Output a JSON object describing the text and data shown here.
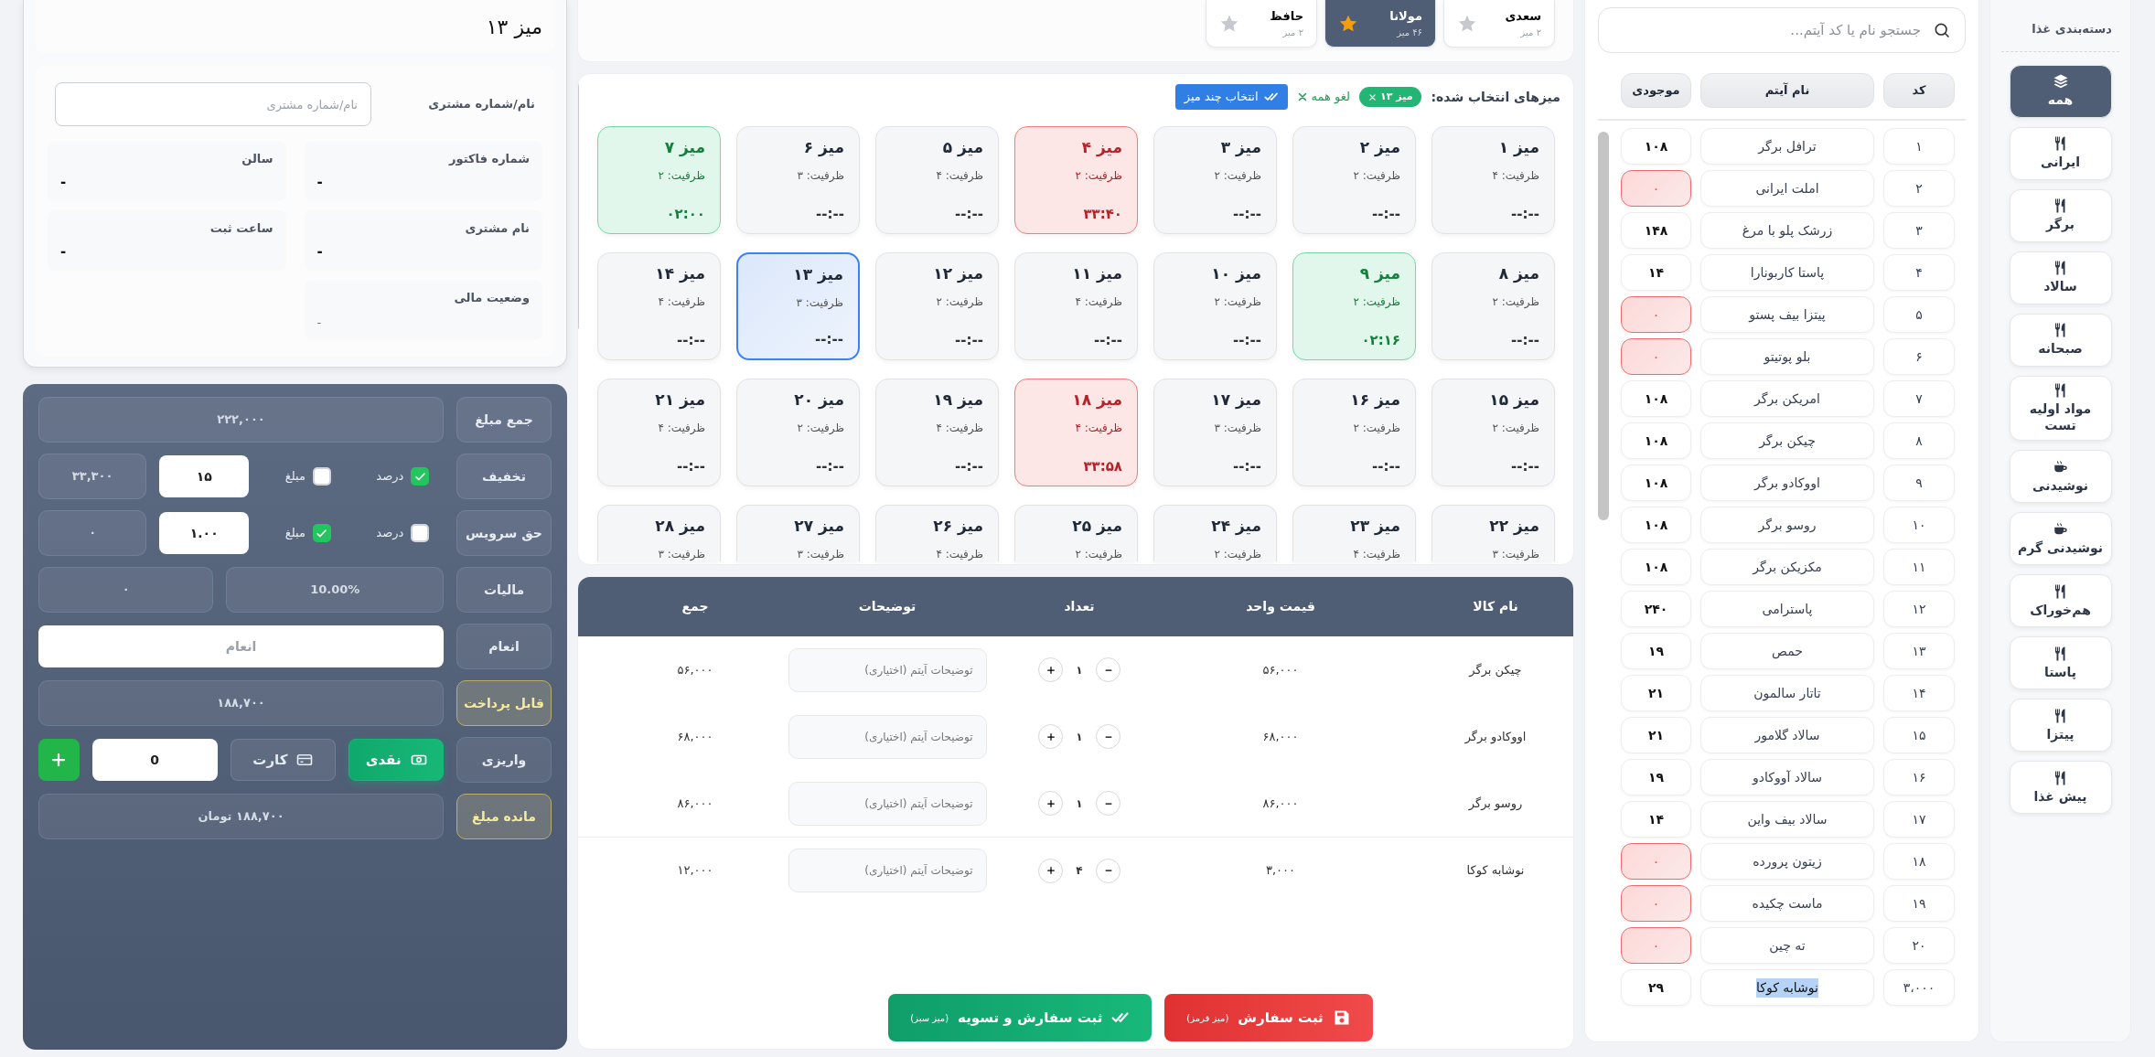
{
  "table_info": {
    "title": "میز ۱۳",
    "customer_label": "نام/شماره مشتری",
    "customer_placeholder": "نام/شماره مشتری",
    "fields": [
      {
        "label": "شماره فاکتور",
        "value": "-",
        "muted": false
      },
      {
        "label": "سالن",
        "value": "-",
        "muted": false
      },
      {
        "label": "نام مشتری",
        "value": "-",
        "muted": false
      },
      {
        "label": "ساعت ثبت",
        "value": "-",
        "muted": false
      },
      {
        "label": "وضعیت مالی",
        "value": "-",
        "muted": true
      }
    ]
  },
  "payment": [
    {
      "kind": "amount",
      "label": "جمع مبلغ",
      "value": "۲۲۲,۰۰۰",
      "highlight": false
    },
    {
      "kind": "adjust",
      "label": "تخفیف",
      "percent": {
        "label": "درصد",
        "checked": true
      },
      "fixed": {
        "label": "مبلغ",
        "checked": false
      },
      "input": "۱۵",
      "result": "۳۳,۳۰۰"
    },
    {
      "kind": "adjust",
      "label": "حق سرویس",
      "percent": {
        "label": "درصد",
        "checked": false
      },
      "fixed": {
        "label": "مبلغ",
        "checked": true
      },
      "input": "۱.۰۰",
      "result": "۰"
    },
    {
      "kind": "tax",
      "label": "مالیات",
      "rate": "10.00%",
      "value": "۰"
    },
    {
      "kind": "tip",
      "label": "انعام",
      "placeholder": "انعام"
    },
    {
      "kind": "amount",
      "label": "قابل پرداخت",
      "value": "۱۸۸,۷۰۰",
      "highlight": true
    },
    {
      "kind": "deposit",
      "label": "واریزی",
      "methods": [
        {
          "label": "نقدی",
          "kind": "cash",
          "selected": true
        },
        {
          "label": "کارت",
          "kind": "card",
          "selected": false
        }
      ],
      "value": "0"
    },
    {
      "kind": "amount",
      "label": "مانده مبلغ",
      "value": "۱۸۸,۷۰۰ تومان",
      "highlight": true
    }
  ],
  "halls": [
    {
      "name": "سعدی",
      "count": "۲ میز",
      "selected": false
    },
    {
      "name": "مولانا",
      "count": "۴۶ میز",
      "selected": true
    },
    {
      "name": "حافظ",
      "count": "۲ میز",
      "selected": false
    }
  ],
  "selection": {
    "label": "میزهای انتخاب شده:",
    "chips": [
      "میز ۱۳"
    ],
    "clear": "لغو همه",
    "multi_button": "انتخاب چند میز"
  },
  "tables": [
    {
      "name": "میز ۱",
      "capacity": "ظرفیت: ۴",
      "time": "--:--",
      "kind": "empty",
      "selected": false
    },
    {
      "name": "میز ۲",
      "capacity": "ظرفیت: ۲",
      "time": "--:--",
      "kind": "empty",
      "selected": false
    },
    {
      "name": "میز ۳",
      "capacity": "ظرفیت: ۲",
      "time": "--:--",
      "kind": "empty",
      "selected": false
    },
    {
      "name": "میز ۴",
      "capacity": "ظرفیت: ۲",
      "time": "۳۳:۴۰",
      "kind": "busy",
      "selected": false
    },
    {
      "name": "میز ۵",
      "capacity": "ظرفیت: ۴",
      "time": "--:--",
      "kind": "empty",
      "selected": false
    },
    {
      "name": "میز ۶",
      "capacity": "ظرفیت: ۳",
      "time": "--:--",
      "kind": "empty",
      "selected": false
    },
    {
      "name": "میز ۷",
      "capacity": "ظرفیت: ۲",
      "time": "۰۲:۰۰",
      "kind": "paid",
      "selected": false
    },
    {
      "name": "میز ۸",
      "capacity": "ظرفیت: ۲",
      "time": "--:--",
      "kind": "empty",
      "selected": false
    },
    {
      "name": "میز ۹",
      "capacity": "ظرفیت: ۲",
      "time": "۰۲:۱۶",
      "kind": "paid",
      "selected": false
    },
    {
      "name": "میز ۱۰",
      "capacity": "ظرفیت: ۲",
      "time": "--:--",
      "kind": "empty",
      "selected": false
    },
    {
      "name": "میز ۱۱",
      "capacity": "ظرفیت: ۴",
      "time": "--:--",
      "kind": "empty",
      "selected": false
    },
    {
      "name": "میز ۱۲",
      "capacity": "ظرفیت: ۲",
      "time": "--:--",
      "kind": "empty",
      "selected": false
    },
    {
      "name": "میز ۱۳",
      "capacity": "ظرفیت: ۳",
      "time": "--:--",
      "kind": "empty",
      "selected": true
    },
    {
      "name": "میز ۱۴",
      "capacity": "ظرفیت: ۴",
      "time": "--:--",
      "kind": "empty",
      "selected": false
    },
    {
      "name": "میز ۱۵",
      "capacity": "ظرفیت: ۲",
      "time": "--:--",
      "kind": "empty",
      "selected": false
    },
    {
      "name": "میز ۱۶",
      "capacity": "ظرفیت: ۲",
      "time": "--:--",
      "kind": "empty",
      "selected": false
    },
    {
      "name": "میز ۱۷",
      "capacity": "ظرفیت: ۳",
      "time": "--:--",
      "kind": "empty",
      "selected": false
    },
    {
      "name": "میز ۱۸",
      "capacity": "ظرفیت: ۴",
      "time": "۳۳:۵۸",
      "kind": "busy",
      "selected": false
    },
    {
      "name": "میز ۱۹",
      "capacity": "ظرفیت: ۴",
      "time": "--:--",
      "kind": "empty",
      "selected": false
    },
    {
      "name": "میز ۲۰",
      "capacity": "ظرفیت: ۲",
      "time": "--:--",
      "kind": "empty",
      "selected": false
    },
    {
      "name": "میز ۲۱",
      "capacity": "ظرفیت: ۴",
      "time": "--:--",
      "kind": "empty",
      "selected": false
    },
    {
      "name": "میز ۲۲",
      "capacity": "ظرفیت: ۳",
      "kind": "empty",
      "selected": false
    },
    {
      "name": "میز ۲۳",
      "capacity": "ظرفیت: ۴",
      "kind": "empty",
      "selected": false
    },
    {
      "name": "میز ۲۴",
      "capacity": "ظرفیت: ۲",
      "kind": "empty",
      "selected": false
    },
    {
      "name": "میز ۲۵",
      "capacity": "ظرفیت: ۲",
      "kind": "empty",
      "selected": false
    },
    {
      "name": "میز ۲۶",
      "capacity": "ظرفیت: ۴",
      "kind": "empty",
      "selected": false
    },
    {
      "name": "میز ۲۷",
      "capacity": "ظرفیت: ۳",
      "kind": "empty",
      "selected": false
    },
    {
      "name": "میز ۲۸",
      "capacity": "ظرفیت: ۳",
      "kind": "empty",
      "selected": false
    }
  ],
  "order": {
    "columns": [
      "نام کالا",
      "قیمت واحد",
      "تعداد",
      "توضیحات",
      "جمع"
    ],
    "rows": [
      {
        "name": "چیکن برگر",
        "price": "۵۶,۰۰۰",
        "qty": "۱",
        "note_placeholder": "توضیحات آیتم (اختیاری)",
        "total": "۵۶,۰۰۰"
      },
      {
        "name": "اووکادو برگر",
        "price": "۶۸,۰۰۰",
        "qty": "۱",
        "note_placeholder": "توضیحات آیتم (اختیاری)",
        "total": "۶۸,۰۰۰"
      },
      {
        "name": "روسو برگر",
        "price": "۸۶,۰۰۰",
        "qty": "۱",
        "note_placeholder": "توضیحات آیتم (اختیاری)",
        "total": "۸۶,۰۰۰"
      },
      {
        "name": "نوشابه کوکا",
        "price": "۳,۰۰۰",
        "qty": "۴",
        "note_placeholder": "توضیحات آیتم (اختیاری)",
        "total": "۱۲,۰۰۰"
      }
    ]
  },
  "actions": [
    {
      "kind": "save",
      "label": "ثبت سفارش",
      "hint": "(میز قرمز)"
    },
    {
      "kind": "settle",
      "label": "ثبت سفارش و تسویه",
      "hint": "(میز سبز)"
    }
  ],
  "item_search": {
    "placeholder": "جستجو نام یا کد آیتم..."
  },
  "item_columns": [
    "کد",
    "نام آیتم",
    "موجودی"
  ],
  "items": [
    {
      "code": "۱",
      "name": "ترافل برگر",
      "stock": "۱۰۸",
      "out_of_stock": false,
      "highlighted": false
    },
    {
      "code": "۲",
      "name": "املت ایرانی",
      "stock": "۰",
      "out_of_stock": true,
      "highlighted": false
    },
    {
      "code": "۳",
      "name": "زرشک پلو با مرغ",
      "stock": "۱۴۸",
      "out_of_stock": false,
      "highlighted": false
    },
    {
      "code": "۴",
      "name": "پاستا کاربونارا",
      "stock": "۱۴",
      "out_of_stock": false,
      "highlighted": false
    },
    {
      "code": "۵",
      "name": "پیتزا بیف پستو",
      "stock": "۰",
      "out_of_stock": true,
      "highlighted": false
    },
    {
      "code": "۶",
      "name": "بلو پوتیتو",
      "stock": "۰",
      "out_of_stock": true,
      "highlighted": false
    },
    {
      "code": "۷",
      "name": "امریکن برگر",
      "stock": "۱۰۸",
      "out_of_stock": false,
      "highlighted": false
    },
    {
      "code": "۸",
      "name": "چیکن برگر",
      "stock": "۱۰۸",
      "out_of_stock": false,
      "highlighted": false
    },
    {
      "code": "۹",
      "name": "اووکادو برگر",
      "stock": "۱۰۸",
      "out_of_stock": false,
      "highlighted": false
    },
    {
      "code": "۱۰",
      "name": "روسو برگر",
      "stock": "۱۰۸",
      "out_of_stock": false,
      "highlighted": false
    },
    {
      "code": "۱۱",
      "name": "مکزیکن برگر",
      "stock": "۱۰۸",
      "out_of_stock": false,
      "highlighted": false
    },
    {
      "code": "۱۲",
      "name": "پاسترامی",
      "stock": "۲۴۰",
      "out_of_stock": false,
      "highlighted": false
    },
    {
      "code": "۱۳",
      "name": "حمص",
      "stock": "۱۹",
      "out_of_stock": false,
      "highlighted": false
    },
    {
      "code": "۱۴",
      "name": "تاتار سالمون",
      "stock": "۲۱",
      "out_of_stock": false,
      "highlighted": false
    },
    {
      "code": "۱۵",
      "name": "سالاد گلامور",
      "stock": "۲۱",
      "out_of_stock": false,
      "highlighted": false
    },
    {
      "code": "۱۶",
      "name": "سالاد آووکادو",
      "stock": "۱۹",
      "out_of_stock": false,
      "highlighted": false
    },
    {
      "code": "۱۷",
      "name": "سالاد بیف واین",
      "stock": "۱۴",
      "out_of_stock": false,
      "highlighted": false
    },
    {
      "code": "۱۸",
      "name": "زیتون پرورده",
      "stock": "۰",
      "out_of_stock": true,
      "highlighted": false
    },
    {
      "code": "۱۹",
      "name": "ماست چکیده",
      "stock": "۰",
      "out_of_stock": true,
      "highlighted": false
    },
    {
      "code": "۲۰",
      "name": "ته چین",
      "stock": "۰",
      "out_of_stock": true,
      "highlighted": false
    },
    {
      "code": "۳،۰۰۰",
      "name": "نوشابه کوکا",
      "stock": "۲۹",
      "out_of_stock": false,
      "highlighted": true
    }
  ],
  "categories": {
    "title": "دسته‌بندی غذا",
    "items": [
      {
        "label": "همه",
        "kind": "layers",
        "selected": true
      },
      {
        "label": "ایرانی",
        "kind": "utensils",
        "selected": false
      },
      {
        "label": "برگر",
        "kind": "utensils",
        "selected": false
      },
      {
        "label": "سالاد",
        "kind": "utensils",
        "selected": false
      },
      {
        "label": "صبحانه",
        "kind": "utensils",
        "selected": false
      },
      {
        "label": "مواد اولیه تست",
        "kind": "utensils",
        "selected": false
      },
      {
        "label": "نوشیدنی",
        "kind": "cup",
        "selected": false
      },
      {
        "label": "نوشیدنی گرم",
        "kind": "cup",
        "selected": false
      },
      {
        "label": "هم‌خوراک",
        "kind": "utensils",
        "selected": false
      },
      {
        "label": "پاستا",
        "kind": "utensils",
        "selected": false
      },
      {
        "label": "پیتزا",
        "kind": "utensils",
        "selected": false
      },
      {
        "label": "پیش غذا",
        "kind": "utensils",
        "selected": false
      }
    ]
  }
}
